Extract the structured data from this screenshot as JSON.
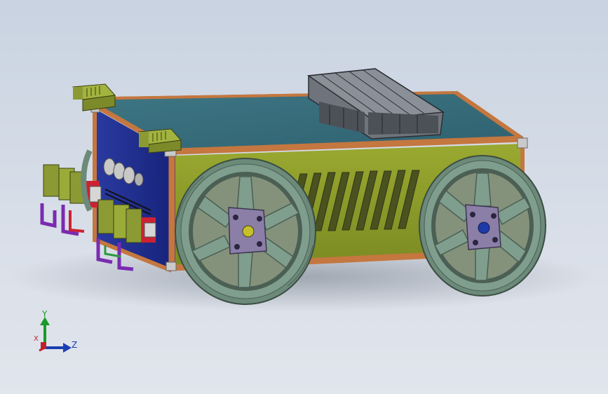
{
  "viewport": {
    "background_top": "#c9d3e1",
    "background_bottom": "#e1e5ec"
  },
  "model": {
    "frame_color": "#b86b3a",
    "top_panel_color": "#3a6f7c",
    "side_panel_color": "#8a9a2a",
    "front_panel_color": "#1e2c8a",
    "wheel_color": "#7f9e8e",
    "hub_color": "#8b7fa8",
    "fan_color": "#6f747c",
    "sensor_color": "#8c9a34"
  },
  "triad": {
    "y_label": "Y",
    "z_label": "Z",
    "x_label": "X",
    "y_color": "#1a9a2a",
    "z_color": "#1a3fb0",
    "x_color": "#c0202a"
  }
}
